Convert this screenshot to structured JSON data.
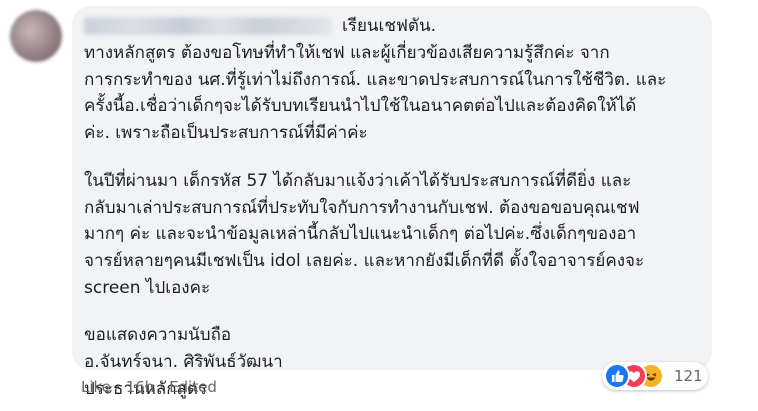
{
  "comment": {
    "header_suffix": "เรียนเชฟตัน.",
    "paragraphs": [
      {
        "lines": [
          "ทางหลักสูตร ต้องขอโทษที่ทำให้เชฟ และผู้เกี่ยวข้องเสียความรู้สึกค่ะ จาก",
          "การกระทำของ นศ.ที่รู้เท่าไม่ถึงการณ์. และขาดประสบการณ์ในการใช้ชีวิต. และ",
          "ครั้งนี้อ.เชื่อว่าเด็กๆจะได้รับบทเรียนนำไปใช้ในอนาคตต่อไปและต้องคิดให้ได้",
          "ค่ะ. เพราะถือเป็นประสบการณ์ที่มีค่าค่ะ"
        ]
      },
      {
        "lines": [
          "ในปีที่ผ่านมา เด็กรหัส 57 ได้กลับมาแจ้งว่าเค้าได้รับประสบการณ์ที่ดียิ่ง และ",
          "กลับมาเล่าประสบการณ์ที่ประทับใจกับการทำงานกับเชฟ. ต้องขอขอบคุณเชฟ",
          "มากๆ ค่ะ และจะนำข้อมูลเหล่านี้กลับไปแนะนำเด็กๆ ต่อไปค่ะ.ซึ่งเด็กๆของอา",
          "จารย์หลายๆคนมีเชฟเป็น idol เลยค่ะ. และหากยังมีเด็กที่ดี ตั้งใจอาจารย์คงจะ",
          "screen ไปเองคะ"
        ]
      },
      {
        "lines": [
          "ขอแสดงความนับถือ",
          "อ.จันทร์จนา. ศิริพันธ์วัฒนา",
          "ประธานหลักสูตร"
        ]
      }
    ]
  },
  "actions": {
    "like": "Like",
    "separator": "·",
    "time": "16h",
    "edited": "Edited"
  },
  "reactions": {
    "icons": [
      "like-icon",
      "love-icon",
      "haha-icon"
    ],
    "count": "121",
    "colors": {
      "like": "#1877f2",
      "love": "#f33e58",
      "haha": "#f7b125"
    }
  }
}
